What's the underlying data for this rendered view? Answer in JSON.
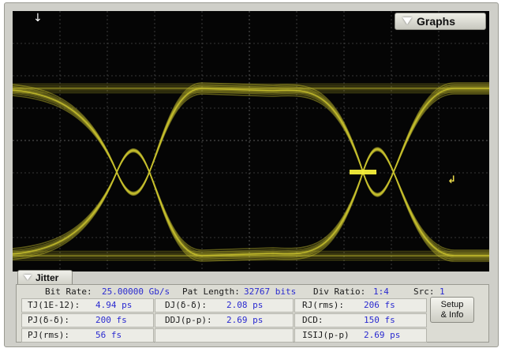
{
  "header": {
    "graphs_label": "Graphs"
  },
  "markers": {
    "trigger_left": "↓",
    "level_right": "↲"
  },
  "tab": {
    "jitter_label": "Jitter"
  },
  "summary": {
    "bit_rate_label": "Bit Rate:",
    "bit_rate_value": "25.00000 Gb/s",
    "pat_length_label": "Pat Length:",
    "pat_length_value": "32767 bits",
    "div_ratio_label": "Div Ratio:",
    "div_ratio_value": "1:4",
    "src_label": "Src:",
    "src_value": "1"
  },
  "measurements": [
    [
      {
        "label": "TJ(1E-12):",
        "value": "4.94 ps"
      },
      {
        "label": "DJ(δ-δ):",
        "value": "2.08 ps"
      },
      {
        "label": "RJ(rms):",
        "value": "206 fs"
      }
    ],
    [
      {
        "label": "PJ(δ-δ):",
        "value": "200 fs"
      },
      {
        "label": "DDJ(p-p):",
        "value": "2.69 ps"
      },
      {
        "label": "DCD:",
        "value": "150 fs"
      }
    ],
    [
      {
        "label": "PJ(rms):",
        "value": "56 fs"
      },
      {
        "label": "",
        "value": ""
      },
      {
        "label": "ISIJ(p-p)",
        "value": "2.69 ps"
      }
    ]
  ],
  "buttons": {
    "setup_line1": "Setup",
    "setup_line2": "& Info"
  },
  "colors": {
    "trace": "#c8c02e",
    "trace_bright": "#f2ea3a",
    "screen": "#050505",
    "grid": "#4a4a4a",
    "value_text": "#2a2ad0"
  }
}
